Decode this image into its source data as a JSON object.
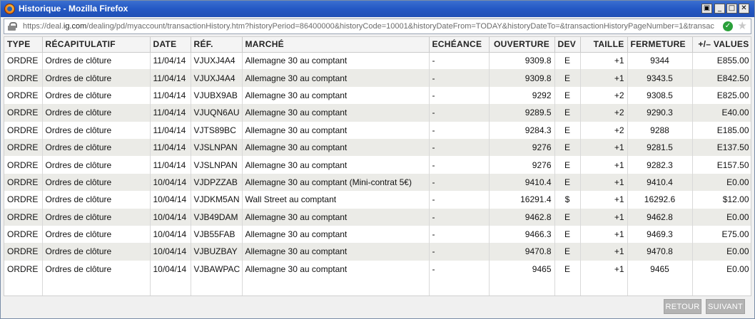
{
  "window": {
    "title": "Historique - Mozilla Firefox"
  },
  "address_bar": {
    "url_prefix": "https://deal.",
    "url_domain": "ig.com",
    "url_suffix": "/dealing/pd/myaccount/transactionHistory.htm?historyPeriod=86400000&historyCode=10001&historyDateFrom=TODAY&historyDateTo=&transactionHistoryPageNumber=1&transac"
  },
  "table": {
    "headers": [
      "TYPE",
      "RÉCAPITULATIF",
      "DATE",
      "RÉF.",
      "MARCHÉ",
      "ECHÉANCE",
      "OUVERTURE",
      "DEV",
      "TAILLE",
      "FERMETURE",
      "+/– VALUES"
    ],
    "rows": [
      [
        "ORDRE",
        "Ordres de clôture",
        "11/04/14",
        "VJUXJ4A4",
        "Allemagne 30 au comptant",
        "-",
        "9309.8",
        "E",
        "+1",
        "9344",
        "E855.00"
      ],
      [
        "ORDRE",
        "Ordres de clôture",
        "11/04/14",
        "VJUXJ4A4",
        "Allemagne 30 au comptant",
        "-",
        "9309.8",
        "E",
        "+1",
        "9343.5",
        "E842.50"
      ],
      [
        "ORDRE",
        "Ordres de clôture",
        "11/04/14",
        "VJUBX9AB",
        "Allemagne 30 au comptant",
        "-",
        "9292",
        "E",
        "+2",
        "9308.5",
        "E825.00"
      ],
      [
        "ORDRE",
        "Ordres de clôture",
        "11/04/14",
        "VJUQN6AU",
        "Allemagne 30 au comptant",
        "-",
        "9289.5",
        "E",
        "+2",
        "9290.3",
        "E40.00"
      ],
      [
        "ORDRE",
        "Ordres de clôture",
        "11/04/14",
        "VJTS89BC",
        "Allemagne 30 au comptant",
        "-",
        "9284.3",
        "E",
        "+2",
        "9288",
        "E185.00"
      ],
      [
        "ORDRE",
        "Ordres de clôture",
        "11/04/14",
        "VJSLNPAN",
        "Allemagne 30 au comptant",
        "-",
        "9276",
        "E",
        "+1",
        "9281.5",
        "E137.50"
      ],
      [
        "ORDRE",
        "Ordres de clôture",
        "11/04/14",
        "VJSLNPAN",
        "Allemagne 30 au comptant",
        "-",
        "9276",
        "E",
        "+1",
        "9282.3",
        "E157.50"
      ],
      [
        "ORDRE",
        "Ordres de clôture",
        "10/04/14",
        "VJDPZZAB",
        "Allemagne 30 au comptant (Mini-contrat 5€)",
        "-",
        "9410.4",
        "E",
        "+1",
        "9410.4",
        "E0.00"
      ],
      [
        "ORDRE",
        "Ordres de clôture",
        "10/04/14",
        "VJDKM5AN",
        "Wall Street au comptant",
        "-",
        "16291.4",
        "$",
        "+1",
        "16292.6",
        "$12.00"
      ],
      [
        "ORDRE",
        "Ordres de clôture",
        "10/04/14",
        "VJB49DAM",
        "Allemagne 30 au comptant",
        "-",
        "9462.8",
        "E",
        "+1",
        "9462.8",
        "E0.00"
      ],
      [
        "ORDRE",
        "Ordres de clôture",
        "10/04/14",
        "VJB55FAB",
        "Allemagne 30 au comptant",
        "-",
        "9466.3",
        "E",
        "+1",
        "9469.3",
        "E75.00"
      ],
      [
        "ORDRE",
        "Ordres de clôture",
        "10/04/14",
        "VJBUZBAY",
        "Allemagne 30 au comptant",
        "-",
        "9470.8",
        "E",
        "+1",
        "9470.8",
        "E0.00"
      ],
      [
        "ORDRE",
        "Ordres de clôture",
        "10/04/14",
        "VJBAWPAC",
        "Allemagne 30 au comptant",
        "-",
        "9465",
        "E",
        "+1",
        "9465",
        "E0.00"
      ]
    ]
  },
  "footer": {
    "back_label": "RETOUR",
    "next_label": "SUIVANT"
  }
}
